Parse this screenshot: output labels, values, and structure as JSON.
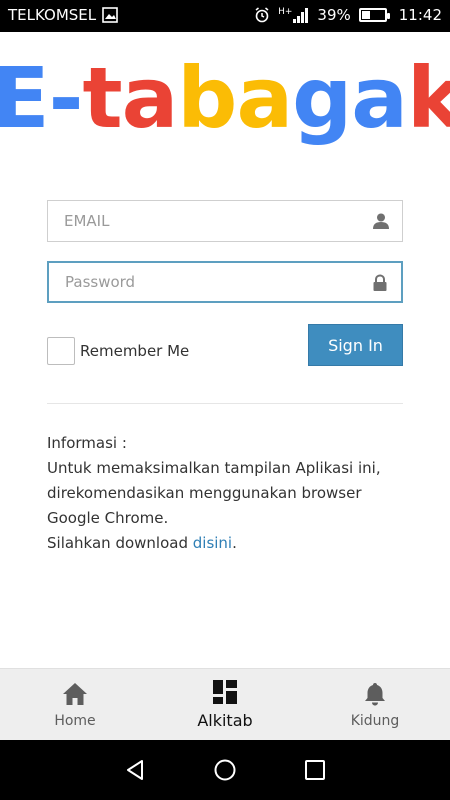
{
  "status_bar": {
    "carrier": "TELKOMSEL",
    "network": "H+",
    "battery_text": "39%",
    "battery_level": 0.39,
    "time": "11:42"
  },
  "logo": {
    "letters": [
      {
        "char": "E",
        "color": "#4285f4"
      },
      {
        "char": "-",
        "color": "#4285f4"
      },
      {
        "char": "t",
        "color": "#ea4335"
      },
      {
        "char": "a",
        "color": "#ea4335"
      },
      {
        "char": "b",
        "color": "#fbbc05"
      },
      {
        "char": "a",
        "color": "#fbbc05"
      },
      {
        "char": "g",
        "color": "#4285f4"
      },
      {
        "char": "a",
        "color": "#4285f4"
      },
      {
        "char": "k",
        "color": "#ea4335"
      }
    ]
  },
  "form": {
    "email_placeholder": "EMAIL",
    "email_value": "",
    "password_placeholder": "Password",
    "password_value": "",
    "remember_label": "Remember Me",
    "remember_checked": false,
    "signin_label": "Sign In"
  },
  "info": {
    "heading": "Informasi :",
    "line1": "Untuk memaksimalkan tampilan Aplikasi ini,",
    "line2": "direkomendasikan menggunakan browser",
    "line3": "Google Chrome.",
    "line4_prefix": "Silahkan download ",
    "link_text": "disini",
    "line4_suffix": "."
  },
  "tabs": [
    {
      "label": "Home",
      "icon": "home-icon",
      "active": false
    },
    {
      "label": "Alkitab",
      "icon": "grid-icon",
      "active": true
    },
    {
      "label": "Kidung",
      "icon": "bell-icon",
      "active": false
    }
  ],
  "colors": {
    "primary": "#3f8dbf",
    "link": "#2f7fb5",
    "focus_border": "#5d9fc0"
  }
}
